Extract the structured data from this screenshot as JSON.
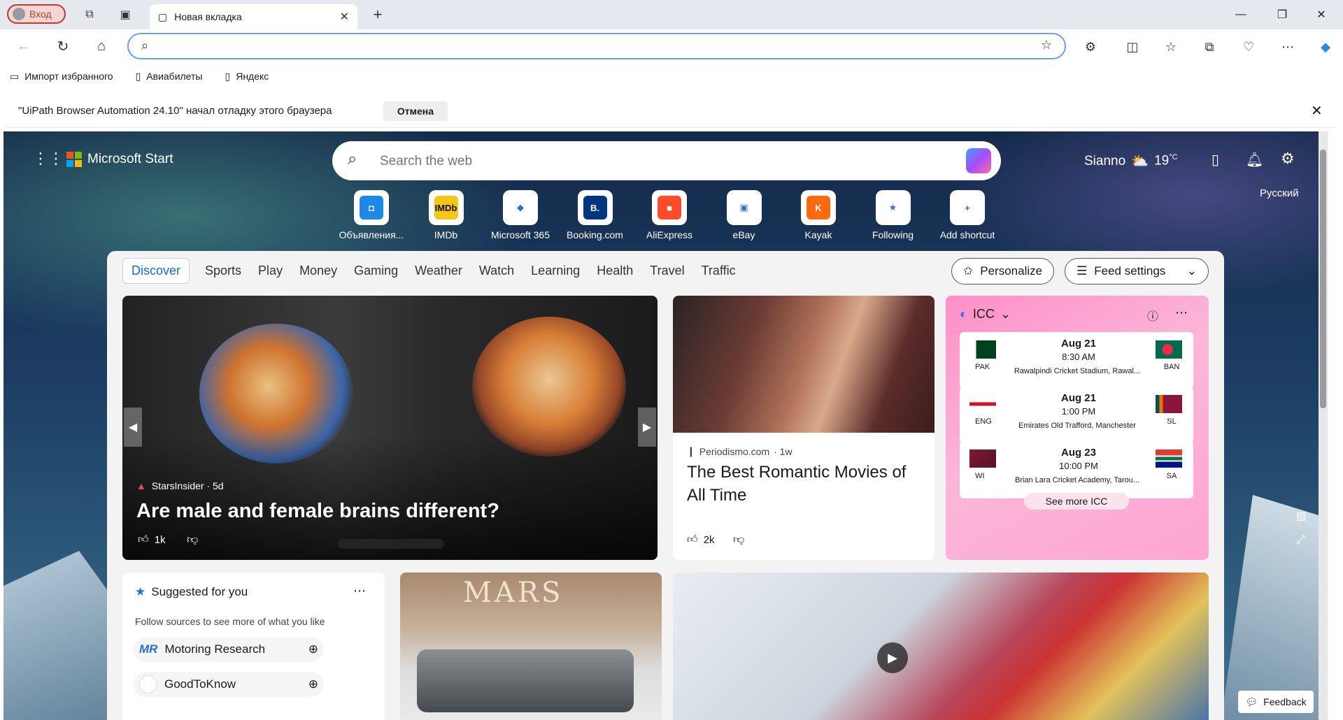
{
  "browser": {
    "login_label": "Вход",
    "tab_title": "Новая вкладка",
    "address_value": "",
    "bookmarks": [
      "Импорт избранного",
      "Авиабилеты",
      "Яндекс"
    ],
    "infobar_text": "\"UiPath Browser Automation 24.10\" начал отладку этого браузера",
    "infobar_cancel": "Отмена"
  },
  "start": {
    "brand": "Microsoft Start",
    "search_placeholder": "Search the web",
    "location": "Sianno",
    "temperature": "19",
    "temp_unit": "°C",
    "language": "Русский",
    "shortcuts": [
      {
        "label": "Объявления...",
        "icon": "objavlenia-icon",
        "glyph": "◘",
        "bg": "#1e88e5"
      },
      {
        "label": "IMDb",
        "icon": "imdb-icon",
        "glyph": "IMDb",
        "bg": "#f5c518"
      },
      {
        "label": "Microsoft 365",
        "icon": "m365-icon",
        "glyph": "◆",
        "bg": "#ffffff"
      },
      {
        "label": "Booking.com",
        "icon": "booking-icon",
        "glyph": "B.",
        "bg": "#003580"
      },
      {
        "label": "AliExpress",
        "icon": "aliexpress-icon",
        "glyph": "■",
        "bg": "#ff4b2b"
      },
      {
        "label": "eBay",
        "icon": "ebay-icon",
        "glyph": "▣",
        "bg": "#ffffff"
      },
      {
        "label": "Kayak",
        "icon": "kayak-icon",
        "glyph": "K",
        "bg": "#ff690f"
      },
      {
        "label": "Following",
        "icon": "following-icon",
        "glyph": "★",
        "bg": "#ffffff"
      },
      {
        "label": "Add shortcut",
        "icon": "plus-icon",
        "glyph": "+",
        "bg": "#ffffff"
      }
    ],
    "tabs": [
      "Discover",
      "Sports",
      "Play",
      "Money",
      "Gaming",
      "Weather",
      "Watch",
      "Learning",
      "Health",
      "Travel",
      "Traffic"
    ],
    "personalize": "Personalize",
    "feed_settings": "Feed settings"
  },
  "hero": {
    "source": "StarsInsider · 5d",
    "title": "Are male and female brains different?",
    "likes": "1k"
  },
  "movie_card": {
    "source": "Periodismo.com",
    "age": "· 1w",
    "title": "The Best Romantic Movies of All Time",
    "likes": "2k"
  },
  "icc": {
    "title": "ICC",
    "see_more": "See more ICC",
    "matches": [
      {
        "date": "Aug 21",
        "time": "8:30 AM",
        "venue": "Rawalpindi Cricket Stadium, Rawal...",
        "home": "PAK",
        "away": "BAN"
      },
      {
        "date": "Aug 21",
        "time": "1:00 PM",
        "venue": "Emirates Old Trafford, Manchester",
        "home": "ENG",
        "away": "SL"
      },
      {
        "date": "Aug 23",
        "time": "10:00 PM",
        "venue": "Brian Lara Cricket Academy, Tarou...",
        "home": "WI",
        "away": "SA"
      }
    ]
  },
  "suggested": {
    "title": "Suggested for you",
    "subtitle": "Follow sources to see more of what you like",
    "items": [
      "Motoring Research",
      "GoodToKnow"
    ]
  },
  "mars_card": {
    "poster_text": "MARS"
  },
  "feedback": "Feedback",
  "colors": {
    "accent": "#1a66c9",
    "icc_pink": "#fbb6d8",
    "login_red": "#c0392b"
  }
}
